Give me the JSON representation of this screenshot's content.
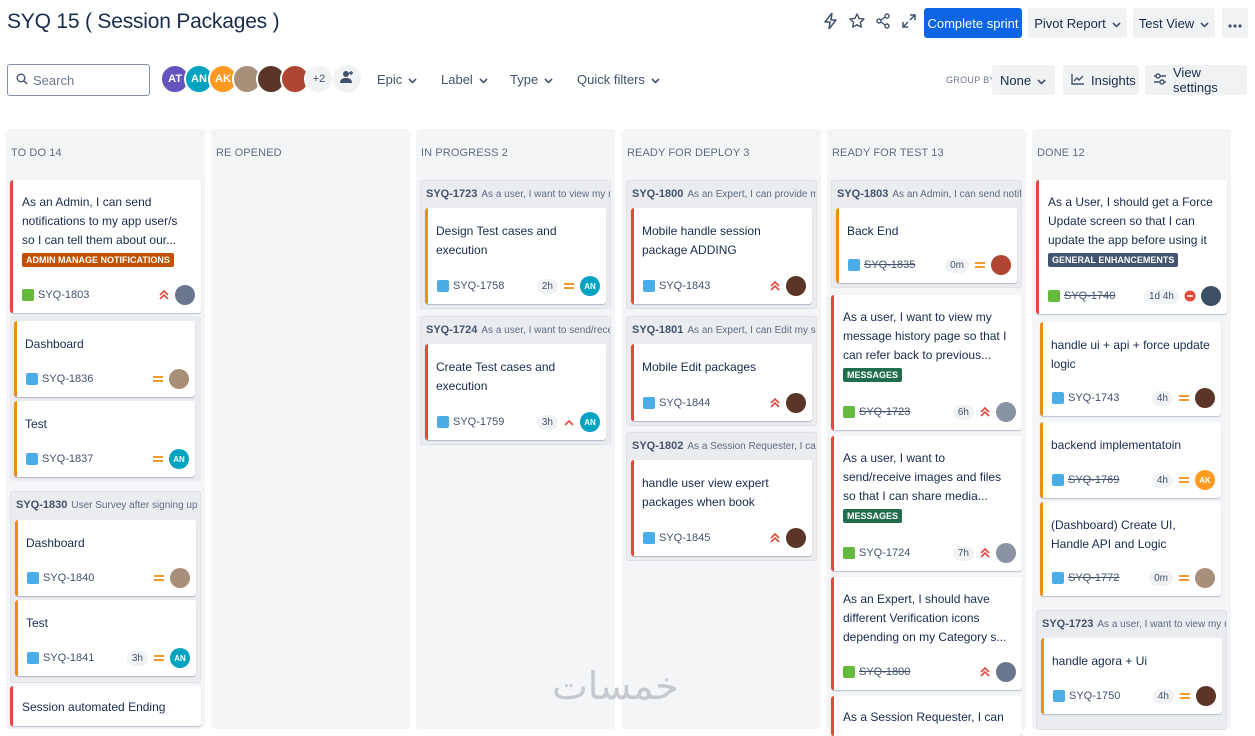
{
  "header": {
    "title": "SYQ 15 ( Session Packages )",
    "complete_sprint": "Complete sprint",
    "pivot_report": "Pivot Report",
    "test_view": "Test View"
  },
  "filters": {
    "search_placeholder": "Search",
    "avatars": [
      {
        "initials": "AT",
        "color": "#6554c0"
      },
      {
        "initials": "AN",
        "color": "#00a3bf"
      },
      {
        "initials": "AK",
        "color": "#ff991f"
      },
      {
        "initials": "",
        "color": "#a88f7a"
      },
      {
        "initials": "",
        "color": "#5a3528"
      },
      {
        "initials": "",
        "color": "#b04632"
      }
    ],
    "more_count": "+2",
    "epic": "Epic",
    "label": "Label",
    "type": "Type",
    "quick_filters": "Quick filters",
    "group_by_label": "GROUP BY",
    "group_by_value": "None",
    "insights": "Insights",
    "view_settings": "View settings"
  },
  "columns": [
    {
      "name": "TO DO 14"
    },
    {
      "name": "RE OPENED"
    },
    {
      "name": "IN PROGRESS 2"
    },
    {
      "name": "READY FOR DEPLOY 3"
    },
    {
      "name": "READY FOR TEST 13"
    },
    {
      "name": "DONE 12"
    }
  ],
  "cards": {
    "todo1": {
      "title": "As an Admin, I can send notifications to my app user/s so I can tell them about our...",
      "label": "ADMIN MANAGE NOTIFICATIONS",
      "key": "SYQ-1803"
    },
    "todo2": {
      "title": "Dashboard",
      "key": "SYQ-1836"
    },
    "todo3": {
      "title": "Test",
      "key": "SYQ-1837",
      "assignee": "AN"
    },
    "todo_parent": {
      "key": "SYQ-1830",
      "summary": "User Survey after signing up"
    },
    "todo4": {
      "title": "Dashboard",
      "key": "SYQ-1840"
    },
    "todo5": {
      "title": "Test",
      "key": "SYQ-1841",
      "est": "3h",
      "assignee": "AN"
    },
    "todo6": {
      "title": "Session automated Ending"
    },
    "ip_parent1": {
      "key": "SYQ-1723",
      "summary": "As a user, I want to view my m..."
    },
    "ip1": {
      "title": "Design Test cases and execution",
      "key": "SYQ-1758",
      "est": "2h",
      "assignee": "AN"
    },
    "ip_parent2": {
      "key": "SYQ-1724",
      "summary": "As a user, I want to send/receiv..."
    },
    "ip2": {
      "title": "Create Test cases and execution",
      "key": "SYQ-1759",
      "est": "3h",
      "assignee": "AN"
    },
    "rd_parent1": {
      "key": "SYQ-1800",
      "summary": "As an Expert, I can provide mor..."
    },
    "rd1": {
      "title": "Mobile handle session package ADDING",
      "key": "SYQ-1843"
    },
    "rd_parent2": {
      "key": "SYQ-1801",
      "summary": "As an Expert, I can Edit my sess..."
    },
    "rd2": {
      "title": "Mobile Edit packages",
      "key": "SYQ-1844"
    },
    "rd_parent3": {
      "key": "SYQ-1802",
      "summary": "As a Session Requester, I can c..."
    },
    "rd3": {
      "title": "handle user view expert packages when book",
      "key": "SYQ-1845"
    },
    "rt_parent1": {
      "key": "SYQ-1803",
      "summary": "As an Admin, I can send notific..."
    },
    "rt1": {
      "title": "Back End",
      "key": "SYQ-1835",
      "est": "0m"
    },
    "rt2": {
      "title": "As a user, I want to view my message history page so that I can refer back to previous...",
      "label": "MESSAGES",
      "key": "SYQ-1723",
      "est": "6h"
    },
    "rt3": {
      "title": "As a user, I want to send/receive images and files so that I can share media...",
      "label": "MESSAGES",
      "key": "SYQ-1724",
      "est": "7h"
    },
    "rt4": {
      "title": "As an Expert, I should have different Verification icons depending on my Category s...",
      "key": "SYQ-1800"
    },
    "rt5": {
      "title": "As a Session Requester, I can"
    },
    "dn1": {
      "title": "As a User, I should get a Force Update screen so that I can update the app before using it",
      "label": "GENERAL ENHANCEMENTS",
      "key": "SYQ-1740",
      "est": "1d 4h"
    },
    "dn2": {
      "title": "handle ui + api + force update logic",
      "key": "SYQ-1743",
      "est": "4h"
    },
    "dn3": {
      "title": "backend implementatoin",
      "key": "SYQ-1769",
      "est": "4h",
      "assignee": "AK"
    },
    "dn4": {
      "title": "(Dashboard) Create UI, Handle API and Logic",
      "key": "SYQ-1772",
      "est": "0m"
    },
    "dn_parent": {
      "key": "SYQ-1723",
      "summary": "As a user, I want to view my m..."
    },
    "dn5": {
      "title": "handle agora + Ui",
      "key": "SYQ-1750",
      "est": "4h"
    }
  },
  "watermark": "خمسات"
}
